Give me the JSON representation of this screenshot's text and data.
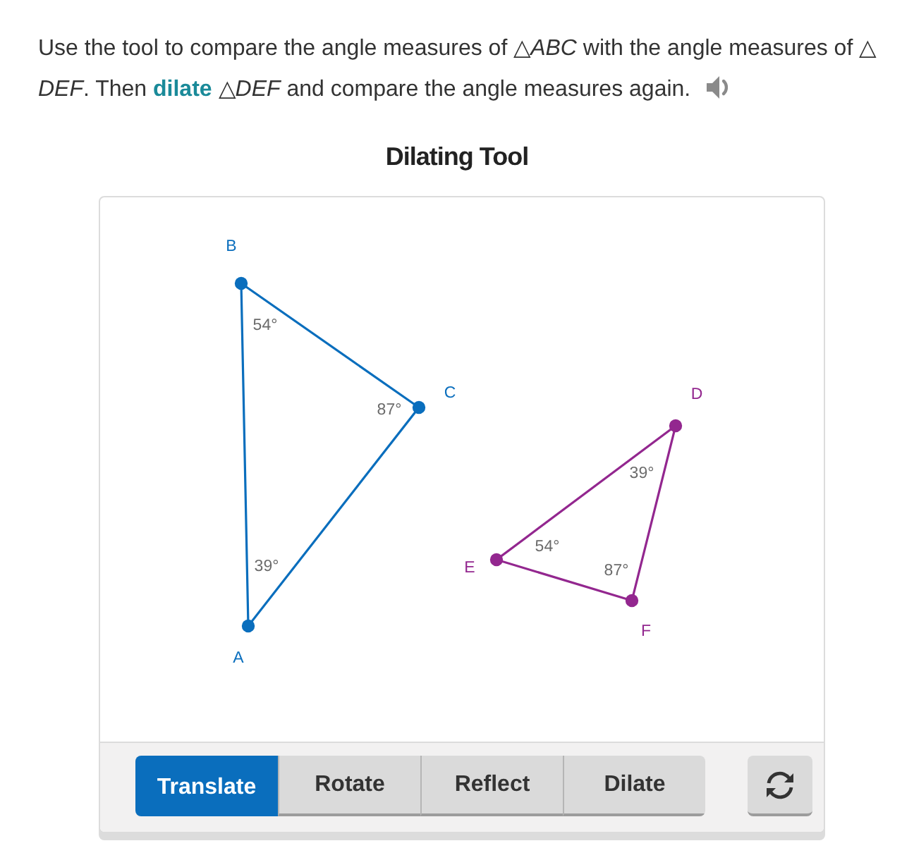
{
  "prompt": {
    "before": "Use the tool to compare the angle measures of △*ABC* with the angle measures of △ *DEF*. Then ",
    "link": "dilate",
    "after": " △*DEF* and compare the angle measures again."
  },
  "tool": {
    "title": "Dilating Tool",
    "triangles": [
      {
        "color": "#0a6ebd",
        "vertices": [
          {
            "label": "B",
            "angle": "54°"
          },
          {
            "label": "C",
            "angle": "87°"
          },
          {
            "label": "A",
            "angle": "39°"
          }
        ]
      },
      {
        "color": "#93278f",
        "vertices": [
          {
            "label": "D",
            "angle": "39°"
          },
          {
            "label": "E",
            "angle": "54°"
          },
          {
            "label": "F",
            "angle": "87°"
          }
        ]
      }
    ],
    "buttons": [
      {
        "label": "Translate",
        "selected": true
      },
      {
        "label": "Rotate",
        "selected": false
      },
      {
        "label": "Reflect",
        "selected": false
      },
      {
        "label": "Dilate",
        "selected": false
      }
    ]
  }
}
